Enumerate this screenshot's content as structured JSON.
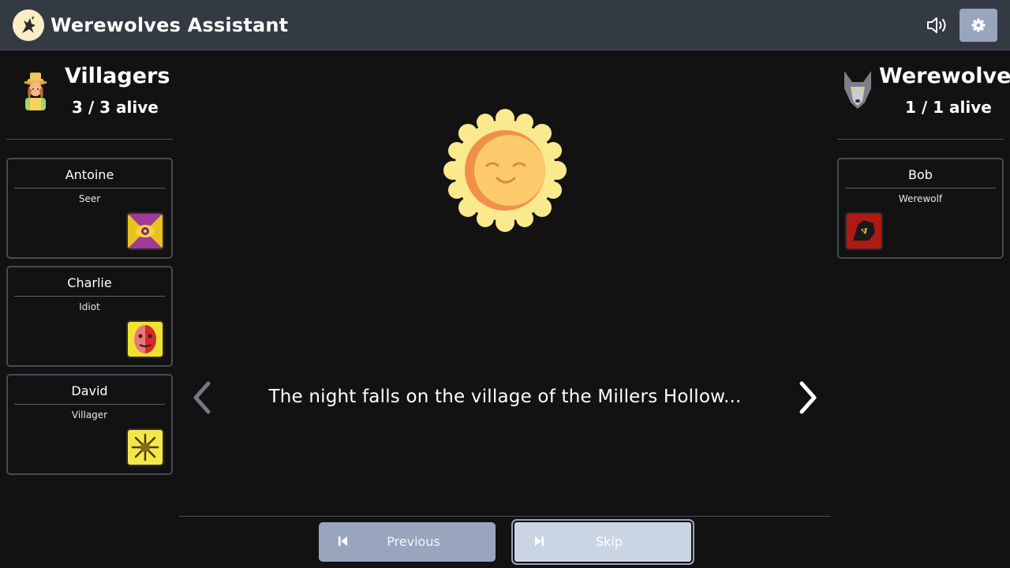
{
  "header": {
    "title": "Werewolves Assistant",
    "logo_icon": "howling-wolf-icon",
    "sound_icon": "speaker-icon",
    "settings_icon": "gear-icon"
  },
  "villagers": {
    "name": "Villagers",
    "count": "3 / 3 alive",
    "icon": "farmer-icon",
    "players": [
      {
        "name": "Antoine",
        "role": "Seer",
        "card_icon": "seer-eye-card-icon"
      },
      {
        "name": "Charlie",
        "role": "Idiot",
        "card_icon": "idiot-mask-card-icon"
      },
      {
        "name": "David",
        "role": "Villager",
        "card_icon": "villager-card-icon"
      }
    ]
  },
  "werewolves": {
    "name": "Werewolves",
    "count": "1 / 1 alive",
    "icon": "wolf-head-icon",
    "players": [
      {
        "name": "Bob",
        "role": "Werewolf",
        "card_icon": "werewolf-card-icon"
      }
    ]
  },
  "main": {
    "phase_icon": "smiling-sun-icon",
    "message": "The night falls on the village of the Millers Hollow..."
  },
  "footer": {
    "previous_label": "Previous",
    "skip_label": "Skip"
  },
  "colors": {
    "topbar": "#343a44",
    "background": "#121212",
    "button": "#98a5bd",
    "skip_button": "#cad5e3"
  }
}
